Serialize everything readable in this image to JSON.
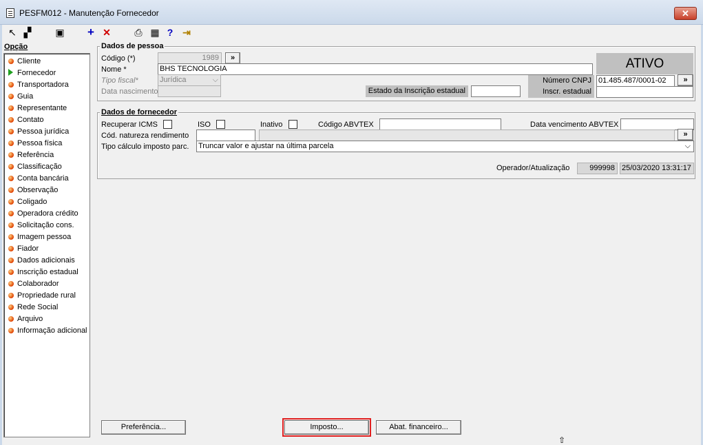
{
  "window": {
    "title": "PESFM012 - Manutenção Fornecedor",
    "close_glyph": "✕"
  },
  "toolbar": {
    "buttons": [
      {
        "icon": "first-record-icon",
        "glyph": "↖"
      },
      {
        "icon": "copy-icon",
        "glyph": "▞"
      },
      {
        "icon": "save-icon",
        "glyph": "▣"
      },
      {
        "icon": "add-icon",
        "glyph": "+"
      },
      {
        "icon": "delete-icon",
        "glyph": "✕"
      },
      {
        "icon": "print-icon",
        "glyph": "⎙"
      },
      {
        "icon": "calculator-icon",
        "glyph": "▦"
      },
      {
        "icon": "help-icon",
        "glyph": "?"
      },
      {
        "icon": "exit-icon",
        "glyph": "⇥"
      }
    ]
  },
  "menu": {
    "heading": "Opção",
    "items": [
      {
        "label": "Cliente",
        "icon": "bullet"
      },
      {
        "label": "Fornecedor",
        "icon": "arrow"
      },
      {
        "label": "Transportadora",
        "icon": "bullet"
      },
      {
        "label": "Guia",
        "icon": "bullet"
      },
      {
        "label": "Representante",
        "icon": "bullet"
      },
      {
        "label": "Contato",
        "icon": "bullet"
      },
      {
        "label": "Pessoa jurídica",
        "icon": "bullet"
      },
      {
        "label": "Pessoa física",
        "icon": "bullet"
      },
      {
        "label": "Referência",
        "icon": "bullet"
      },
      {
        "label": "Classificação",
        "icon": "bullet"
      },
      {
        "label": "Conta bancária",
        "icon": "bullet"
      },
      {
        "label": "Observação",
        "icon": "bullet"
      },
      {
        "label": "Coligado",
        "icon": "bullet"
      },
      {
        "label": "Operadora crédito",
        "icon": "bullet"
      },
      {
        "label": "Solicitação cons.",
        "icon": "bullet"
      },
      {
        "label": "Imagem pessoa",
        "icon": "bullet"
      },
      {
        "label": "Fiador",
        "icon": "bullet"
      },
      {
        "label": "Dados adicionais",
        "icon": "bullet"
      },
      {
        "label": "Inscrição estadual",
        "icon": "bullet"
      },
      {
        "label": "Colaborador",
        "icon": "bullet"
      },
      {
        "label": "Propriedade rural",
        "icon": "bullet"
      },
      {
        "label": "Rede Social",
        "icon": "bullet"
      },
      {
        "label": "Arquivo",
        "icon": "bullet"
      },
      {
        "label": "Informação adicional",
        "icon": "bullet"
      }
    ]
  },
  "pessoa": {
    "title": "Dados de pessoa",
    "codigo_label": "Código (*)",
    "codigo_value": "1989",
    "lookup_glyph": "»",
    "nome_label": "Nome *",
    "nome_value": "BHS TECNOLOGIA",
    "tipo_fiscal_label": "Tipo fiscal*",
    "tipo_fiscal_value": "Jurídica",
    "data_nasc_label": "Data nascimento",
    "estado_ie_label": "Estado da Inscrição estadual",
    "status": "ATIVO",
    "cnpj_label": "Número CNPJ",
    "cnpj_value": "01.485.487/0001-02",
    "ie_label": "Inscr. estadual"
  },
  "fornecedor": {
    "title": "Dados de fornecedor",
    "recuperar_icms_label": "Recuperar ICMS",
    "iso_label": "ISO",
    "inativo_label": "Inativo",
    "codigo_abvtex_label": "Código ABVTEX",
    "data_venc_abvtex_label": "Data vencimento ABVTEX",
    "cod_natureza_label": "Cód. natureza rendimento",
    "tipo_calculo_label": "Tipo cálculo imposto parc.",
    "tipo_calculo_value": "Truncar valor e ajustar na última parcela",
    "operador_label": "Operador/Atualização",
    "operador_value": "999998",
    "atualizacao_value": "25/03/2020 13:31:17"
  },
  "buttons": {
    "preferencia": "Preferência...",
    "imposto": "Imposto...",
    "abat_financeiro": "Abat. financeiro..."
  },
  "colors": {
    "highlight_border": "#e02020",
    "status_bg": "#c0c0c0"
  }
}
